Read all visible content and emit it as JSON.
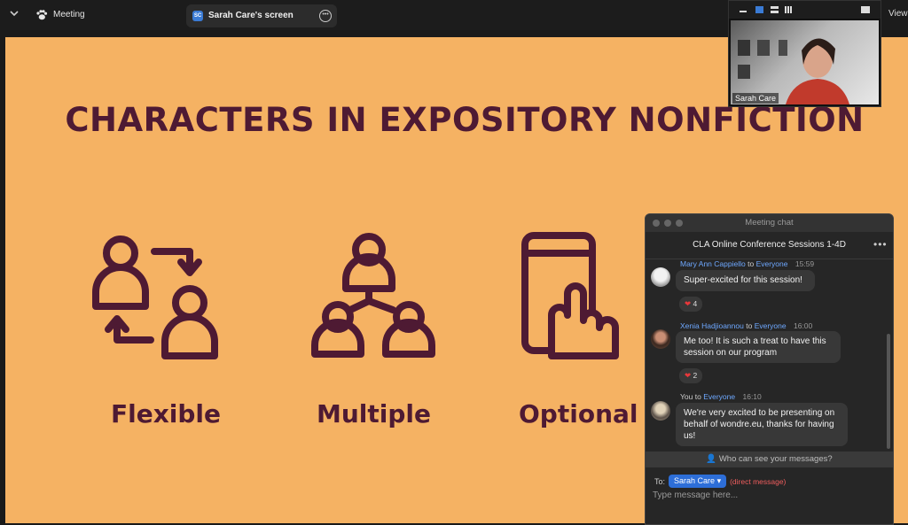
{
  "topbar": {
    "meeting_label": "Meeting",
    "screen_tab_badge": "SC",
    "screen_tab_label": "Sarah Care's screen",
    "view_label": "View"
  },
  "slide": {
    "title": "CHARACTERS IN EXPOSITORY NONFICTION",
    "items": [
      {
        "label": "Flexible",
        "icon": "swap-people-icon"
      },
      {
        "label": "Multiple",
        "icon": "people-network-icon"
      },
      {
        "label": "Optional",
        "icon": "phone-tap-icon"
      }
    ],
    "background_color": "#f5b263",
    "text_color": "#4e1a33"
  },
  "video": {
    "participant_name": "Sarah Care"
  },
  "chat": {
    "window_title": "Meeting chat",
    "header_title": "CLA Online Conference Sessions 1-4D",
    "messages": [
      {
        "sender": "Mary Ann Cappiello",
        "to_word": "to",
        "recipient": "Everyone",
        "time": "15:59",
        "text": "Super-excited for this session!",
        "reaction_count": "4"
      },
      {
        "sender": "Xenia Hadjioannou",
        "to_word": "to",
        "recipient": "Everyone",
        "time": "16:00",
        "text": "Me too! It is such a treat to have this session on our program",
        "reaction_count": "2"
      },
      {
        "sender": "You",
        "to_word": "to",
        "recipient": "Everyone",
        "time": "16:10",
        "text": "We're very excited to be presenting on behalf of wondre.eu, thanks for having us!"
      }
    ],
    "who_can_see": "Who can see your messages?",
    "to_label": "To:",
    "recipient_chip": "Sarah Care",
    "direct_note": "(direct message)",
    "input_placeholder": "Type message here..."
  }
}
